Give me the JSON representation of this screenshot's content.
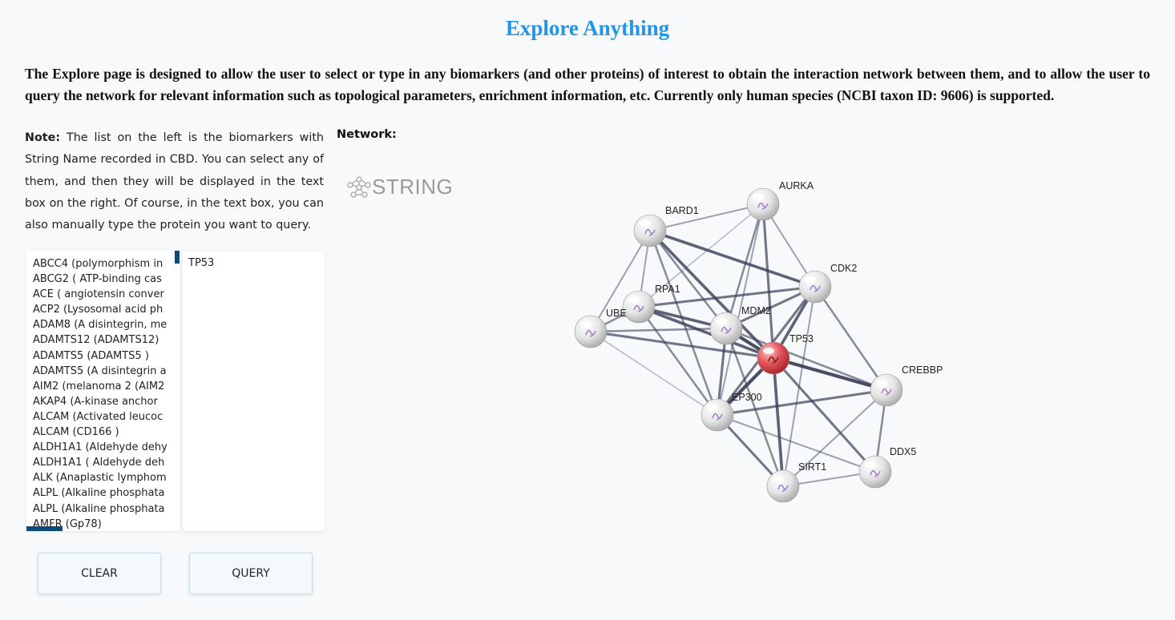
{
  "page": {
    "title": "Explore Anything",
    "intro": "The Explore page is designed to allow the user to select or type in any biomarkers (and other proteins) of interest to obtain the interaction network between them, and to allow the user to query the network for relevant information such as topological parameters, enrichment information, etc. Currently only human species (NCBI taxon ID: 9606) is supported."
  },
  "note": {
    "label": "Note:",
    "text": " The list on the left is the biomarkers with String Name recorded in CBD. You can select any of them, and then they will be displayed in the text box on the right. Of course, in the text box, you can also manually type the protein you want to query."
  },
  "network": {
    "label": "Network:",
    "logo_text": "STRING",
    "nodes": [
      "AURKA",
      "BARD1",
      "CDK2",
      "RPA1",
      "UBE",
      "MDM2",
      "TP53",
      "CREBBP",
      "EP300",
      "DDX5",
      "SIRT1"
    ],
    "highlight_color": "#d9383f"
  },
  "biomarker_list": [
    "ABCC4   (polymorphism in",
    "ABCG2   ( ATP-binding cas",
    "ACE   ( angiotensin conver",
    "ACP2   (Lysosomal acid ph",
    "ADAM8   (A disintegrin, me",
    "ADAMTS12   (ADAMTS12)",
    "ADAMTS5   (ADAMTS5 )",
    "ADAMTS5   (A disintegrin a",
    "AIM2   (melanoma 2 (AIM2",
    "AKAP4   (A-kinase anchor",
    "ALCAM   (Activated leucoc",
    "ALCAM   (CD166 )",
    "ALDH1A1   (Aldehyde dehy",
    "ALDH1A1   ( Aldehyde deh",
    "ALK   (Anaplastic lymphom",
    "ALPL   (Alkaline phosphata",
    "ALPL   (Alkaline phosphata",
    "AMFR   (Gp78)"
  ],
  "query_box": {
    "value": "TP53"
  },
  "buttons": {
    "clear": "CLEAR",
    "query": "QUERY"
  }
}
